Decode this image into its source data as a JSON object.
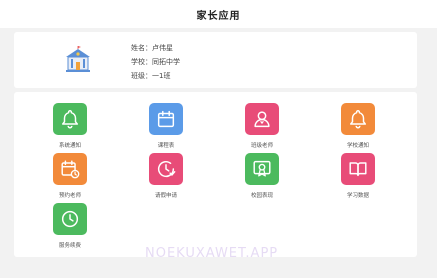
{
  "header": {
    "title": "家长应用"
  },
  "profile": {
    "name_label": "姓名：",
    "name_value": "卢伟星",
    "school_label": "学校：",
    "school_value": "同拓中学",
    "class_label": "班级：",
    "class_value": "一1班",
    "icon": "school-building-icon"
  },
  "apps": [
    {
      "label": "系统通知",
      "color": "#4cba5e",
      "icon": "bell-icon"
    },
    {
      "label": "课程表",
      "color": "#5b9be8",
      "icon": "calendar-icon"
    },
    {
      "label": "班级老师",
      "color": "#e84c78",
      "icon": "teacher-icon"
    },
    {
      "label": "学校通知",
      "color": "#f28a3a",
      "icon": "bell-icon"
    },
    {
      "label": "预约老师",
      "color": "#f28a3a",
      "icon": "appointment-icon"
    },
    {
      "label": "请假申请",
      "color": "#e84c78",
      "icon": "leave-request-icon"
    },
    {
      "label": "校园表现",
      "color": "#4cba5e",
      "icon": "award-icon"
    },
    {
      "label": "学习数据",
      "color": "#e84c78",
      "icon": "book-icon"
    },
    {
      "label": "服务续费",
      "color": "#4cba5e",
      "icon": "clock-icon"
    }
  ],
  "watermark": "NOEKUXAWET.APP"
}
